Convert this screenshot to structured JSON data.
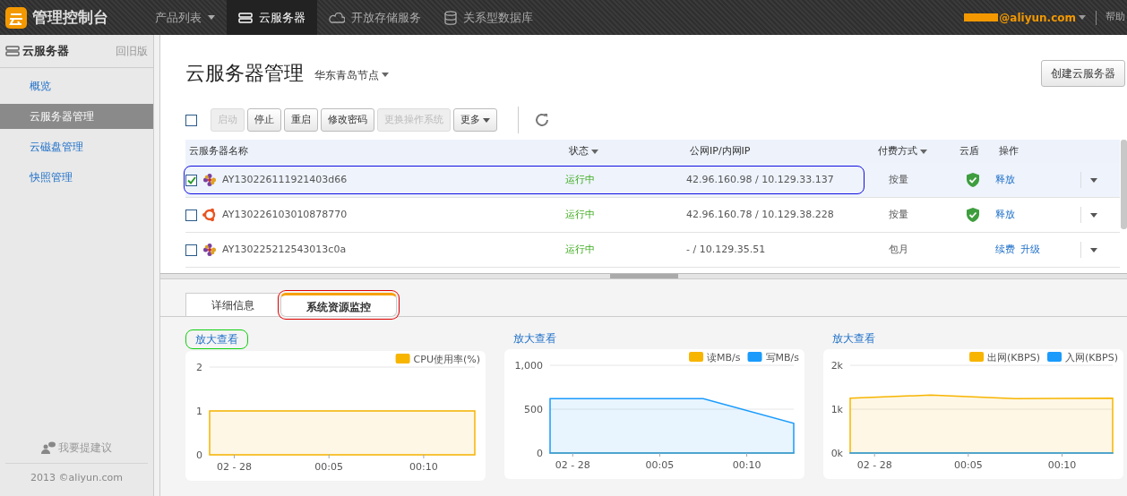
{
  "topbar": {
    "logo": "管理控制台",
    "menu": [
      {
        "label": "产品列表",
        "kind": "dropdown",
        "selected": false
      },
      {
        "label": "云服务器",
        "kind": "server",
        "selected": true
      },
      {
        "label": "开放存储服务",
        "kind": "cloud",
        "selected": false
      },
      {
        "label": "关系型数据库",
        "kind": "database",
        "selected": false
      }
    ],
    "account": "@aliyun.com",
    "help": "帮助"
  },
  "sidebar": {
    "title": "云服务器",
    "old_version": "回旧版",
    "items": [
      {
        "label": "概览",
        "selected": false
      },
      {
        "label": "云服务器管理",
        "selected": true
      },
      {
        "label": "云磁盘管理",
        "selected": false
      },
      {
        "label": "快照管理",
        "selected": false
      }
    ],
    "feedback": "我要提建议",
    "footer": "2013 ©aliyun.com"
  },
  "page": {
    "title": "云服务器管理",
    "region": "华东青岛节点",
    "create_button": "创建云服务器"
  },
  "toolbar": {
    "select_all": false,
    "buttons": [
      {
        "label": "启动",
        "disabled": true,
        "dropdown": false
      },
      {
        "label": "停止",
        "disabled": false,
        "dropdown": false
      },
      {
        "label": "重启",
        "disabled": false,
        "dropdown": false
      },
      {
        "label": "修改密码",
        "disabled": false,
        "dropdown": false
      },
      {
        "label": "更换操作系统",
        "disabled": true,
        "dropdown": false
      },
      {
        "label": "更多",
        "disabled": false,
        "dropdown": true
      }
    ]
  },
  "table": {
    "columns": [
      {
        "label": "云服务器名称",
        "sortable": false
      },
      {
        "label": "状态",
        "sortable": true
      },
      {
        "label": "公网IP/内网IP",
        "sortable": false
      },
      {
        "label": "付费方式",
        "sortable": true
      },
      {
        "label": "云盾",
        "sortable": false
      },
      {
        "label": "操作",
        "sortable": false
      }
    ],
    "rows": [
      {
        "checked": true,
        "selected": true,
        "annotated": true,
        "kind": "flower",
        "name": "AY130226111921403d66",
        "status": "运行中",
        "ip": "42.96.160.98 / 10.129.33.137",
        "billing": "按量",
        "shielded": true,
        "actions": [
          "释放"
        ]
      },
      {
        "checked": false,
        "selected": false,
        "annotated": false,
        "kind": "ring",
        "name": "AY130226103010878770",
        "status": "运行中",
        "ip": "42.96.160.78 / 10.129.38.228",
        "billing": "按量",
        "shielded": true,
        "actions": [
          "释放"
        ]
      },
      {
        "checked": false,
        "selected": false,
        "annotated": false,
        "kind": "flower",
        "name": "AY130225212543013c0a",
        "status": "运行中",
        "ip": "- / 10.129.35.51",
        "billing": "包月",
        "shielded": false,
        "actions": [
          "续费",
          "升级"
        ]
      }
    ]
  },
  "details": {
    "tabs": [
      {
        "label": "详细信息",
        "selected": false,
        "annotated": false
      },
      {
        "label": "系统资源监控",
        "selected": true,
        "annotated": true
      }
    ],
    "panels": [
      {
        "link": "放大查看",
        "annotated": true,
        "chart_data": {
          "type": "area",
          "x": [
            -1.3,
            3,
            7.5,
            12.7
          ],
          "series": [
            {
              "name": "CPU使用率(%)",
              "color": "#f7b500",
              "values": [
                1,
                1,
                1,
                1
              ]
            }
          ],
          "legend": "top-right",
          "xlim": [
            -1.3,
            12.7
          ],
          "ylim": [
            0,
            2
          ],
          "xticks": [
            {
              "value": 0,
              "label": "02 - 28"
            },
            {
              "value": 5,
              "label": "00:05"
            },
            {
              "value": 10,
              "label": "00:10"
            }
          ],
          "yticks": [
            {
              "value": 0,
              "label": "0"
            },
            {
              "value": 1,
              "label": "1"
            },
            {
              "value": 2,
              "label": "2"
            }
          ]
        }
      },
      {
        "link": "放大查看",
        "annotated": false,
        "chart_data": {
          "type": "area",
          "x": [
            -1.3,
            3,
            7.5,
            12.7
          ],
          "series": [
            {
              "name": "读MB/s",
              "color": "#f7b500",
              "values": [
                0,
                0,
                0,
                0
              ]
            },
            {
              "name": "写MB/s",
              "color": "#1a9bfc",
              "values": [
                620,
                620,
                620,
                340
              ]
            }
          ],
          "legend": "top-right",
          "xlim": [
            -1.3,
            12.7
          ],
          "ylim": [
            0,
            1000
          ],
          "xticks": [
            {
              "value": 0,
              "label": "02 - 28"
            },
            {
              "value": 5,
              "label": "00:05"
            },
            {
              "value": 10,
              "label": "00:10"
            }
          ],
          "yticks": [
            {
              "value": 0,
              "label": "0"
            },
            {
              "value": 500,
              "label": "500"
            },
            {
              "value": 1000,
              "label": "1,000"
            }
          ]
        }
      },
      {
        "link": "放大查看",
        "annotated": false,
        "chart_data": {
          "type": "area",
          "x": [
            -1.3,
            3,
            7.5,
            12.7
          ],
          "series": [
            {
              "name": "出网(KBPS)",
              "color": "#f7b500",
              "values": [
                1250,
                1320,
                1240,
                1250
              ]
            },
            {
              "name": "入网(KBPS)",
              "color": "#1a9bfc",
              "values": [
                0,
                0,
                0,
                0
              ]
            }
          ],
          "legend": "top-right",
          "xlim": [
            -1.3,
            12.7
          ],
          "ylim": [
            0,
            2000
          ],
          "xticks": [
            {
              "value": 0,
              "label": "02 - 28"
            },
            {
              "value": 5,
              "label": "00:05"
            },
            {
              "value": 10,
              "label": "00:10"
            }
          ],
          "yticks": [
            {
              "value": 0,
              "label": "0k"
            },
            {
              "value": 1000,
              "label": "1k"
            },
            {
              "value": 2000,
              "label": "2k"
            }
          ]
        }
      }
    ]
  }
}
